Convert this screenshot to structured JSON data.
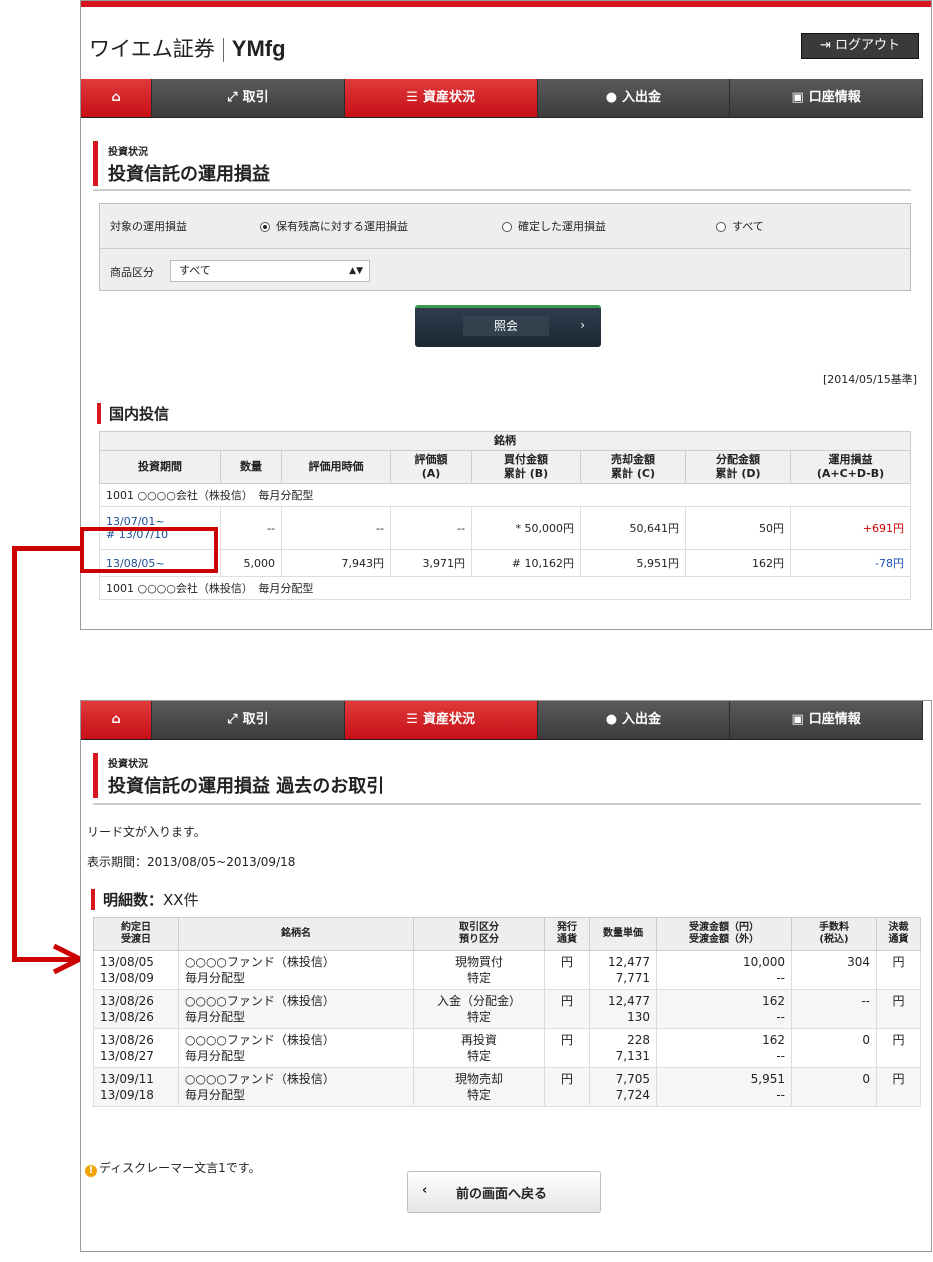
{
  "header": {
    "logo_text": "ワイエム証券",
    "logo_brand": "YMfg",
    "logout_label": "ログアウト"
  },
  "nav": [
    {
      "label": "",
      "icon": "home-icon"
    },
    {
      "label": "取引",
      "icon": "exchange-icon"
    },
    {
      "label": "資産状況",
      "icon": "database-icon",
      "active": true
    },
    {
      "label": "入出金",
      "icon": "moneybag-icon"
    },
    {
      "label": "口座情報",
      "icon": "id-card-icon"
    }
  ],
  "page1": {
    "breadcrumb": "投資状況",
    "title": "投資信託の運用損益",
    "filter": {
      "label": "対象の運用損益",
      "options": [
        "保有残高に対する運用損益",
        "確定した運用損益",
        "すべて"
      ],
      "selected": 0,
      "category_label": "商品区分",
      "category_value": "すべて"
    },
    "query_button": "照会",
    "base_date": "[2014/05/15基準]",
    "section": "国内投信",
    "table": {
      "group_header": "銘柄",
      "headers": [
        "投資期間",
        "数量",
        "評価用時価",
        "評価額\n(A)",
        "買付金額\n累計 (B)",
        "売却金額\n累計 (C)",
        "分配金額\n累計 (D)",
        "運用損益\n(A+C+D-B)"
      ],
      "fund_name": "1001 ○○○○会社（株投信）　毎月分配型",
      "rows": [
        {
          "period1": "13/07/01~",
          "period2": "# 13/07/10",
          "qty": "--",
          "price": "--",
          "value": "--",
          "buy": "* 50,000円",
          "sell": "50,641円",
          "dist": "50円",
          "pl": "+691円"
        },
        {
          "period1": "13/08/05~",
          "period2": "",
          "qty": "5,000",
          "price": "7,943円",
          "value": "3,971円",
          "buy": "# 10,162円",
          "sell": "5,951円",
          "dist": "162円",
          "pl": "-78円"
        }
      ]
    }
  },
  "page2": {
    "breadcrumb": "投資状況",
    "title": "投資信託の運用損益 過去のお取引",
    "lead": "リード文が入ります。",
    "period": "表示期間：2013/08/05~2013/09/18",
    "count_label": "明細数：",
    "count_value": "XX件",
    "headers": [
      "約定日\n受渡日",
      "銘柄名",
      "取引区分\n預り区分",
      "発行\n通貨",
      "数量単価",
      "受渡金額（円）\n受渡金額（外）",
      "手数料\n(税込)",
      "決裁\n通貨"
    ],
    "rows": [
      {
        "d1": "13/08/05",
        "d2": "13/08/09",
        "n1": "○○○○ファンド（株投信）",
        "n2": "毎月分配型",
        "t1": "現物買付",
        "t2": "特定",
        "cur": "円",
        "q1": "12,477",
        "q2": "7,771",
        "a1": "10,000",
        "a2": "--",
        "fee": "304",
        "sc": "円"
      },
      {
        "d1": "13/08/26",
        "d2": "13/08/26",
        "n1": "○○○○ファンド（株投信）",
        "n2": "毎月分配型",
        "t1": "入金（分配金）",
        "t2": "特定",
        "cur": "円",
        "q1": "12,477",
        "q2": "130",
        "a1": "162",
        "a2": "--",
        "fee": "--",
        "sc": "円"
      },
      {
        "d1": "13/08/26",
        "d2": "13/08/27",
        "n1": "○○○○ファンド（株投信）",
        "n2": "毎月分配型",
        "t1": "再投資",
        "t2": "特定",
        "cur": "円",
        "q1": "228",
        "q2": "7,131",
        "a1": "162",
        "a2": "--",
        "fee": "0",
        "sc": "円"
      },
      {
        "d1": "13/09/11",
        "d2": "13/09/18",
        "n1": "○○○○ファンド（株投信）",
        "n2": "毎月分配型",
        "t1": "現物売却",
        "t2": "特定",
        "cur": "円",
        "q1": "7,705",
        "q2": "7,724",
        "a1": "5,951",
        "a2": "--",
        "fee": "0",
        "sc": "円"
      }
    ],
    "disclaimer": "ディスクレーマー文言1です。",
    "back_button": "前の画面へ戻る"
  },
  "colors": {
    "accent": "#d7161f",
    "nav": "#4b4b4b",
    "link": "#1a4f94"
  }
}
